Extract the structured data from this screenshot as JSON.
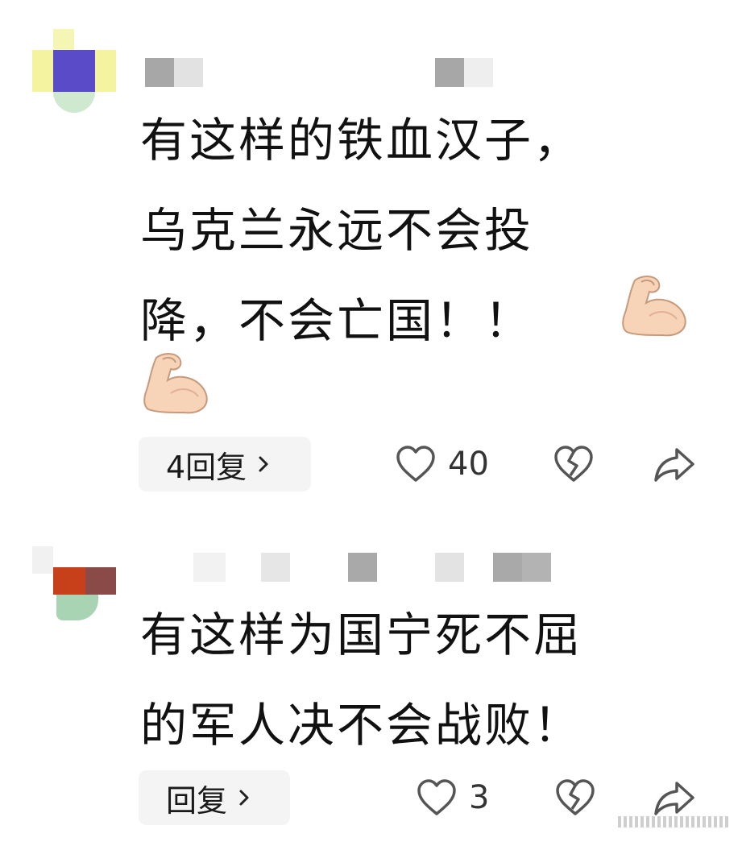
{
  "comments": [
    {
      "text_lines": [
        "有这样的铁血汉子，",
        "乌克兰永远不会投",
        "降，不会亡国！！"
      ],
      "reply_label": "4回复",
      "like_count": "40",
      "icons": {
        "like": "heart-outline-icon",
        "dislike": "broken-heart-icon",
        "share": "share-arrow-icon",
        "emoji": "flexed-biceps-emoji"
      }
    },
    {
      "text_lines": [
        "有这样为国宁死不屈",
        "的军人决不会战败！"
      ],
      "reply_label": "回复",
      "like_count": "3",
      "icons": {
        "like": "heart-outline-icon",
        "dislike": "broken-heart-icon",
        "share": "share-arrow-icon"
      }
    }
  ],
  "colors": {
    "text": "#111111",
    "icon_stroke": "#555555",
    "pill_bg": "#f4f4f4",
    "avatar1": [
      "#5a4bc8",
      "#f4f4a0"
    ],
    "avatar2": [
      "#c8401a",
      "#8a4a48",
      "#a8d4b4"
    ]
  }
}
